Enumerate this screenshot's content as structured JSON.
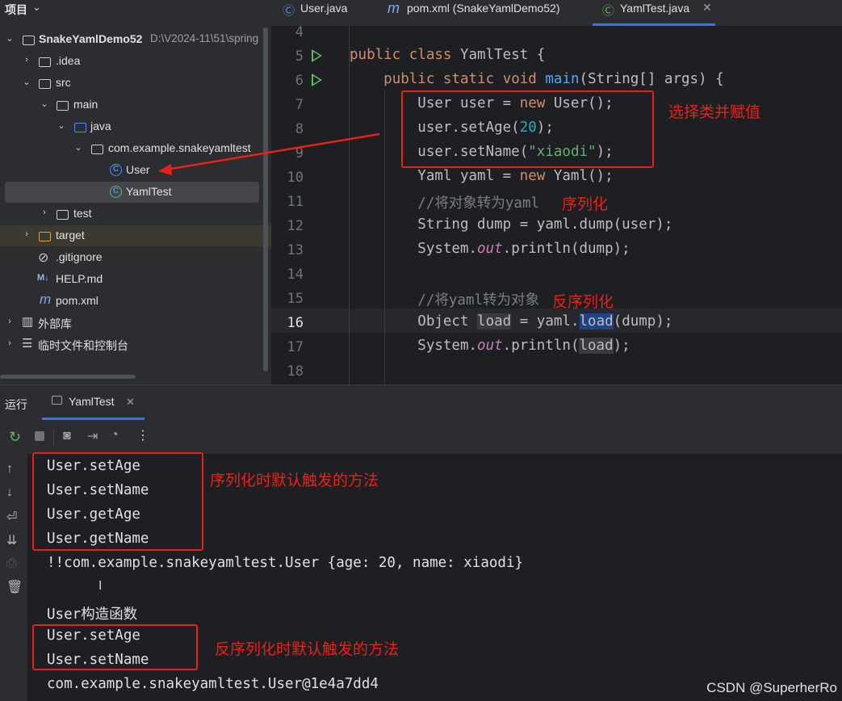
{
  "project_panel": {
    "title": "项目",
    "tree": [
      {
        "label": "SnakeYamlDemo52",
        "path": "D:\\V2024-11\\51\\spring"
      },
      {
        "label": ".idea"
      },
      {
        "label": "src"
      },
      {
        "label": "main"
      },
      {
        "label": "java"
      },
      {
        "label": "com.example.snakeyamltest"
      },
      {
        "label": "User"
      },
      {
        "label": "YamlTest"
      },
      {
        "label": "test"
      },
      {
        "label": "target"
      },
      {
        "label": ".gitignore"
      },
      {
        "label": "HELP.md",
        "icon_text": "M↓"
      },
      {
        "label": "pom.xml",
        "icon_text": "m"
      },
      {
        "label": "外部库"
      },
      {
        "label": "临时文件和控制台"
      }
    ]
  },
  "editor_tabs": [
    {
      "label": "User.java",
      "icon": "class-icon"
    },
    {
      "label": "pom.xml (SnakeYamlDemo52)",
      "icon": "maven-icon"
    },
    {
      "label": "YamlTest.java",
      "icon": "class-icon",
      "active": true
    }
  ],
  "editor": {
    "line_numbers": [
      "4",
      "5",
      "6",
      "7",
      "8",
      "9",
      "10",
      "11",
      "12",
      "13",
      "14",
      "15",
      "16",
      "17",
      "18"
    ],
    "code": [
      "",
      "public class YamlTest {",
      "    public static void main(String[] args) {",
      "        User user = new User();",
      "        user.setAge(20);",
      "        user.setName(\"xiaodi\");",
      "        Yaml yaml = new Yaml();",
      "        //将对象转为yaml",
      "        String dump = yaml.dump(user);",
      "        System.out.println(dump);",
      "",
      "        //将yaml转为对象",
      "        Object load = yaml.load(dump);",
      "        System.out.println(load);",
      ""
    ],
    "annotations": {
      "select_class": "选择类并赋值",
      "serialize": "序列化",
      "deserialize": "反序列化"
    }
  },
  "run_panel": {
    "title": "运行",
    "tab_label": "YamlTest",
    "output": [
      "User.setAge",
      "User.setName",
      "User.getAge",
      "User.getName",
      "!!com.example.snakeyamltest.User {age: 20, name: xiaodi}",
      "",
      "User构造函数",
      "User.setAge",
      "User.setName",
      "com.example.snakeyamltest.User@1e4a7dd4"
    ],
    "annotations": {
      "serialize_methods": "序列化时默认触发的方法",
      "deserialize_methods": "反序列化时默认触发的方法"
    }
  },
  "watermark": "CSDN @SuperherRo",
  "colors": {
    "accent": "#3574f0",
    "annotation_red": "#e8221a",
    "run_green": "#5fb865"
  }
}
